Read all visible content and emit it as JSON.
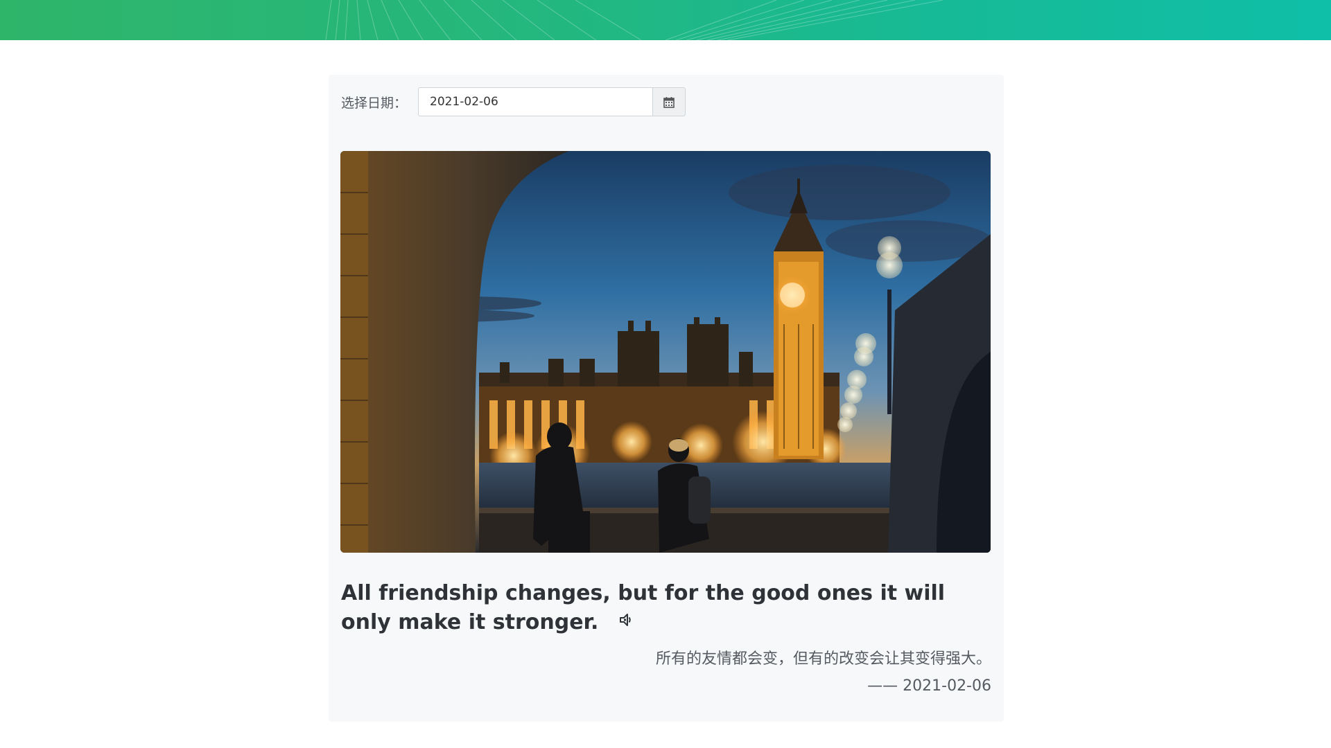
{
  "date_picker": {
    "label": "选择日期：",
    "value": "2021-02-06",
    "button_icon": "calendar-icon"
  },
  "quote": {
    "english": "All friendship changes, but for the good ones it will only make it stronger.",
    "chinese": "所有的友情都会变，但有的改变会让其变得强大。",
    "dash": "——",
    "date": "2021-02-06",
    "audio_icon": "speaker-icon"
  },
  "colors": {
    "banner_start": "#2fb56a",
    "banner_end": "#0fbfa8",
    "card_bg": "#f7f8fa",
    "text_dark": "#2f3338",
    "text_muted": "#555a60"
  }
}
